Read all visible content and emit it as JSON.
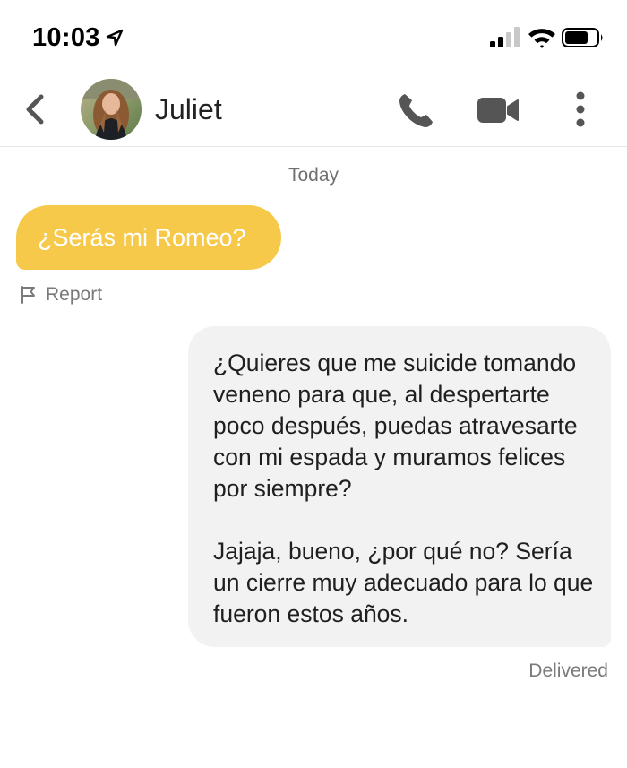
{
  "status_bar": {
    "time": "10:03"
  },
  "header": {
    "contact_name": "Juliet"
  },
  "chat": {
    "day_label": "Today",
    "incoming_message": "¿Serás mi Romeo?",
    "report_label": "Report",
    "outgoing_message": {
      "paragraph1": "¿Quieres que me suicide tomando veneno para que, al despertarte poco después, puedas atravesarte con mi espada y muramos felices por siempre?",
      "paragraph2": "Jajaja, bueno, ¿por qué no? Sería un cierre muy adecuado para lo que fueron estos años."
    },
    "delivery_status": "Delivered"
  },
  "icons": {
    "back": "chevron-left",
    "call": "phone",
    "video": "video-camera",
    "more": "vertical-ellipsis",
    "report": "flag",
    "status": [
      "location-arrow",
      "cellular-signal",
      "wifi",
      "battery"
    ]
  },
  "colors": {
    "incoming_bubble": "#f6c94a",
    "outgoing_bubble": "#f2f2f2",
    "header_icons": "#555555"
  }
}
